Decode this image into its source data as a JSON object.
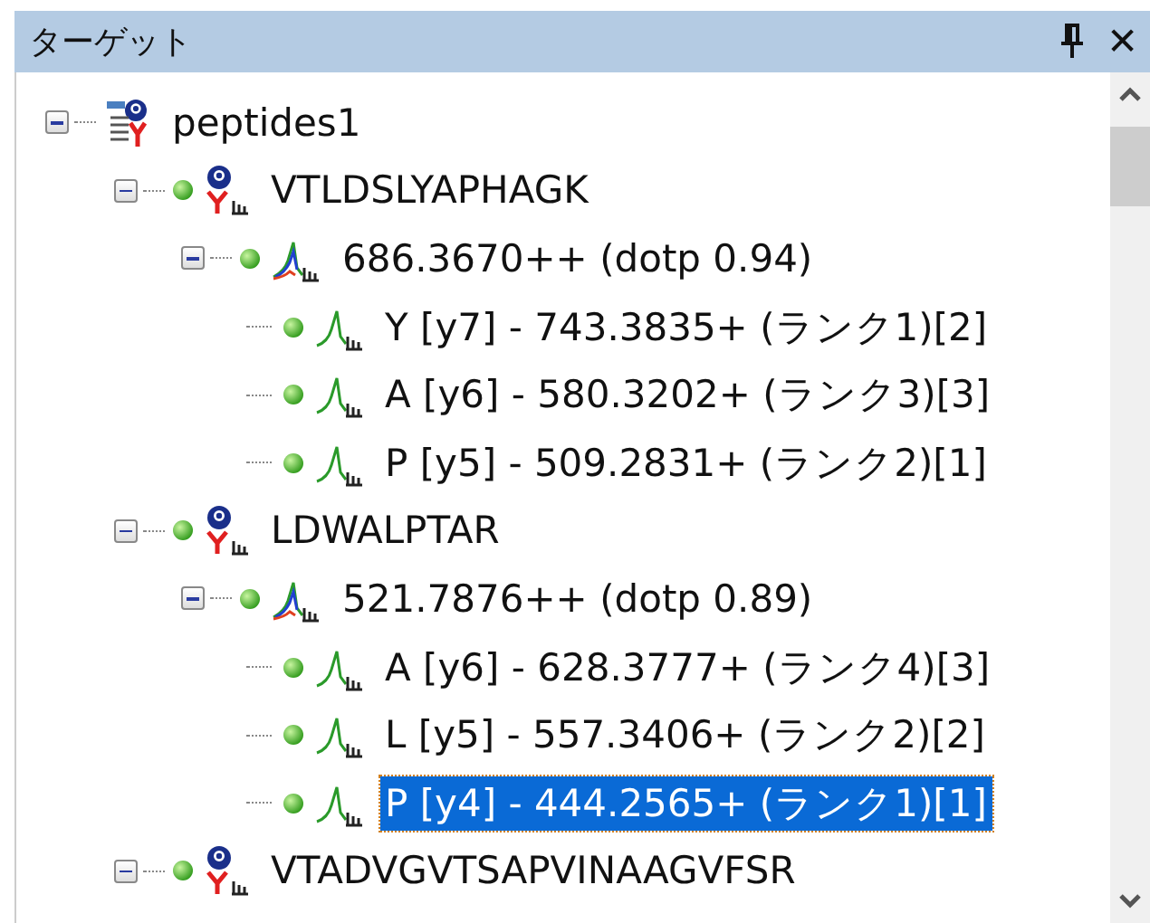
{
  "panel": {
    "title": "ターゲット",
    "close": "✕"
  },
  "tree": [
    {
      "kind": "document",
      "label": "peptides1",
      "expanded": true,
      "selected": false,
      "children": [
        {
          "kind": "peptide",
          "label": "VTLDSLYAPHAGK",
          "expanded": true,
          "selected": false,
          "children": [
            {
              "kind": "precursor",
              "label": "686.3670++ (dotp 0.94)",
              "expanded": true,
              "selected": false,
              "children": [
                {
                  "kind": "transition",
                  "label": "Y [y7] - 743.3835+ (ランク1)[2]",
                  "selected": false
                },
                {
                  "kind": "transition",
                  "label": "A [y6] - 580.3202+ (ランク3)[3]",
                  "selected": false
                },
                {
                  "kind": "transition",
                  "label": "P [y5] - 509.2831+ (ランク2)[1]",
                  "selected": false
                }
              ]
            }
          ]
        },
        {
          "kind": "peptide",
          "label": "LDWALPTAR",
          "expanded": true,
          "selected": false,
          "children": [
            {
              "kind": "precursor",
              "label": "521.7876++ (dotp 0.89)",
              "expanded": true,
              "selected": false,
              "children": [
                {
                  "kind": "transition",
                  "label": "A [y6] - 628.3777+ (ランク4)[3]",
                  "selected": false
                },
                {
                  "kind": "transition",
                  "label": "L [y5] - 557.3406+ (ランク2)[2]",
                  "selected": false
                },
                {
                  "kind": "transition",
                  "label": "P [y4] - 444.2565+ (ランク1)[1]",
                  "selected": true
                }
              ]
            }
          ]
        },
        {
          "kind": "peptide",
          "label": "VTADVGVTSAPVINAAGVFSR",
          "expanded": true,
          "selected": false
        }
      ]
    }
  ]
}
